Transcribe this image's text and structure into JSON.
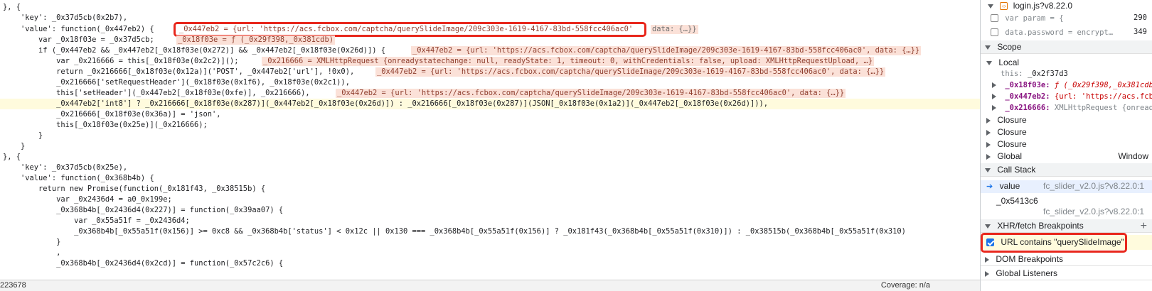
{
  "editor": {
    "lines": [
      "}, {",
      "    'key': _0x37d5cb(0x2b7),",
      "    'value': function(_0x447eb2) {",
      "        var _0x18f03e = _0x37d5cb;",
      "        if (_0x447eb2 && _0x447eb2[_0x18f03e(0x272)] && _0x447eb2[_0x18f03e(0x26d)]) {",
      "            var _0x216666 = this[_0x18f03e(0x2c2)]();",
      "            return _0x216666[_0x18f03e(0x12a)]('POST', _0x447eb2['url'], !0x0),",
      "            _0x216666['setRequestHeader'](_0x18f03e(0x1f6), _0x18f03e(0x2c1)),",
      "            this['setHeader'](_0x447eb2[_0x18f03e(0xfe)], _0x216666),",
      "            _0x447eb2['int8'] ? _0x216666[_0x18f03e(0x287)](_0x447eb2[_0x18f03e(0x26d)]) : _0x216666[_0x18f03e(0x287)](JSON[_0x18f03e(0x1a2)](_0x447eb2[_0x18f03e(0x26d)])),",
      "            _0x216666[_0x18f03e(0x36a)] = 'json',",
      "            this[_0x18f03e(0x25e)](_0x216666);",
      "        }",
      "    }",
      "}, {",
      "    'key': _0x37d5cb(0x25e),",
      "    'value': function(_0x368b4b) {",
      "        return new Promise(function(_0x181f43, _0x38515b) {",
      "            var _0x2436d4 = a0_0x199e;",
      "            _0x368b4b[_0x2436d4(0x227)] = function(_0x39aa07) {",
      "                var _0x55a51f = _0x2436d4;",
      "                _0x368b4b[_0x55a51f(0x156)] >= 0xc8 && _0x368b4b['status'] < 0x12c || 0x130 === _0x368b4b[_0x55a51f(0x156)] ? _0x181f43(_0x368b4b[_0x55a51f(0x310)]) : _0x38515b(_0x368b4b[_0x55a51f(0x310)",
      "            }",
      "            ,",
      "            _0x368b4b[_0x2436d4(0x2cd)] = function(_0x57c2c6) {"
    ],
    "annotations": {
      "value_line": "_0x447eb2 = {url: 'https://acs.fcbox.com/captcha/querySlideImage/209c303e-1619-4167-83bd-558fcc406ac0'",
      "value_line_tail": "data: {…}}",
      "var_line": "_0x18f03e = ƒ (_0x29f398,_0x381cdb)",
      "if_line": "_0x447eb2 = {url: 'https://acs.fcbox.com/captcha/querySlideImage/209c303e-1619-4167-83bd-558fcc406ac0', data: {…}}",
      "var216_line": "_0x216666 = XMLHttpRequest {onreadystatechange: null, readyState: 1, timeout: 0, withCredentials: false, upload: XMLHttpRequestUpload, …}",
      "return_line": "_0x447eb2 = {url: 'https://acs.fcbox.com/captcha/querySlideImage/209c303e-1619-4167-83bd-558fcc406ac0', data: {…}}",
      "setheader_line": "_0x447eb2 = {url: 'https://acs.fcbox.com/captcha/querySlideImage/209c303e-1619-4167-83bd-558fcc406ac0', data: {…}}"
    },
    "highlight_line_index": 9
  },
  "statusbar": {
    "position": "223678",
    "coverage": "Coverage: n/a"
  },
  "panel": {
    "file": "login.js?v8.22.0",
    "breakpoints": [
      {
        "text": "var param = {",
        "line": "290"
      },
      {
        "text": "data.password = encrypt…",
        "line": "349"
      }
    ],
    "scope_label": "Scope",
    "local_label": "Local",
    "local_items": [
      {
        "key": "this:",
        "value": "_0x2f37d3"
      },
      {
        "key": "_0x18f03e:",
        "value": "ƒ (_0x29f398,_0x381cdb"
      },
      {
        "key": "_0x447eb2:",
        "value": "{url: 'https://acs.fcb"
      },
      {
        "key": "_0x216666:",
        "value": "XMLHttpRequest {onread"
      }
    ],
    "closures": [
      "Closure",
      "Closure",
      "Closure"
    ],
    "global_label": "Global",
    "global_value": "Window",
    "callstack_label": "Call Stack",
    "callstack": [
      {
        "fn": "value",
        "loc": "fc_slider_v2.0.js?v8.22.0:1"
      },
      {
        "fn": "_0x5413c6",
        "loc": "fc_slider_v2.0.js?v8.22.0:1"
      }
    ],
    "xhr_label": "XHR/fetch Breakpoints",
    "xhr_item": "URL contains \"querySlideImage\"",
    "dom_label": "DOM Breakpoints",
    "global_listeners_label": "Global Listeners"
  }
}
